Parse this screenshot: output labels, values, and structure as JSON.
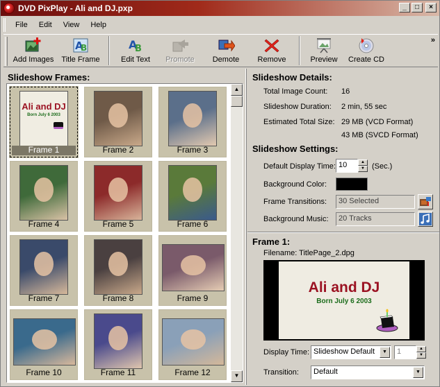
{
  "window": {
    "title": "DVD PixPlay - Ali and DJ.pxp"
  },
  "menu": [
    "File",
    "Edit",
    "View",
    "Help"
  ],
  "toolbar": {
    "add_images": "Add Images",
    "title_frame": "Title Frame",
    "edit_text": "Edit Text",
    "promote": "Promote",
    "demote": "Demote",
    "remove": "Remove",
    "preview": "Preview",
    "create_cd": "Create CD",
    "overflow": "»"
  },
  "frames_panel": {
    "title": "Slideshow Frames:",
    "frames": [
      {
        "label": "Frame 1"
      },
      {
        "label": "Frame 2"
      },
      {
        "label": "Frame 3"
      },
      {
        "label": "Frame 4"
      },
      {
        "label": "Frame 5"
      },
      {
        "label": "Frame 6"
      },
      {
        "label": "Frame 7"
      },
      {
        "label": "Frame 8"
      },
      {
        "label": "Frame 9"
      },
      {
        "label": "Frame 10"
      },
      {
        "label": "Frame 11"
      },
      {
        "label": "Frame 12"
      }
    ],
    "title_card": {
      "line1": "Ali and DJ",
      "line2": "Born July 6 2003"
    }
  },
  "details": {
    "heading": "Slideshow Details:",
    "total_image_count_label": "Total Image Count:",
    "total_image_count": "16",
    "duration_label": "Slideshow Duration:",
    "duration": "2 min, 55 sec",
    "size_label": "Estimated Total Size:",
    "size_vcd": "29 MB (VCD Format)",
    "size_svcd": "43 MB (SVCD Format)"
  },
  "settings": {
    "heading": "Slideshow Settings:",
    "display_time_label": "Default Display Time:",
    "display_time": "10",
    "display_time_unit": "(Sec.)",
    "bg_color_label": "Background Color:",
    "bg_color": "#000000",
    "transitions_label": "Frame Transitions:",
    "transitions": "30 Selected",
    "music_label": "Background Music:",
    "music": "20 Tracks"
  },
  "frame_detail": {
    "heading": "Frame 1:",
    "filename": "Filename: TitlePage_2.dpg",
    "preview_line1": "Ali and DJ",
    "preview_line2": "Born July 6 2003",
    "display_time_label": "Display Time:",
    "display_time": "Slideshow Default",
    "display_time_num": "1",
    "transition_label": "Transition:",
    "transition": "Default"
  },
  "scroll": {
    "up": "▲",
    "down": "▼"
  },
  "window_buttons": {
    "min": "_",
    "max": "□",
    "close": "×"
  },
  "colors": {
    "frame_bg": "#c8c2aa",
    "title_red": "#9b1222",
    "subtitle_green": "#1b6c1b"
  }
}
